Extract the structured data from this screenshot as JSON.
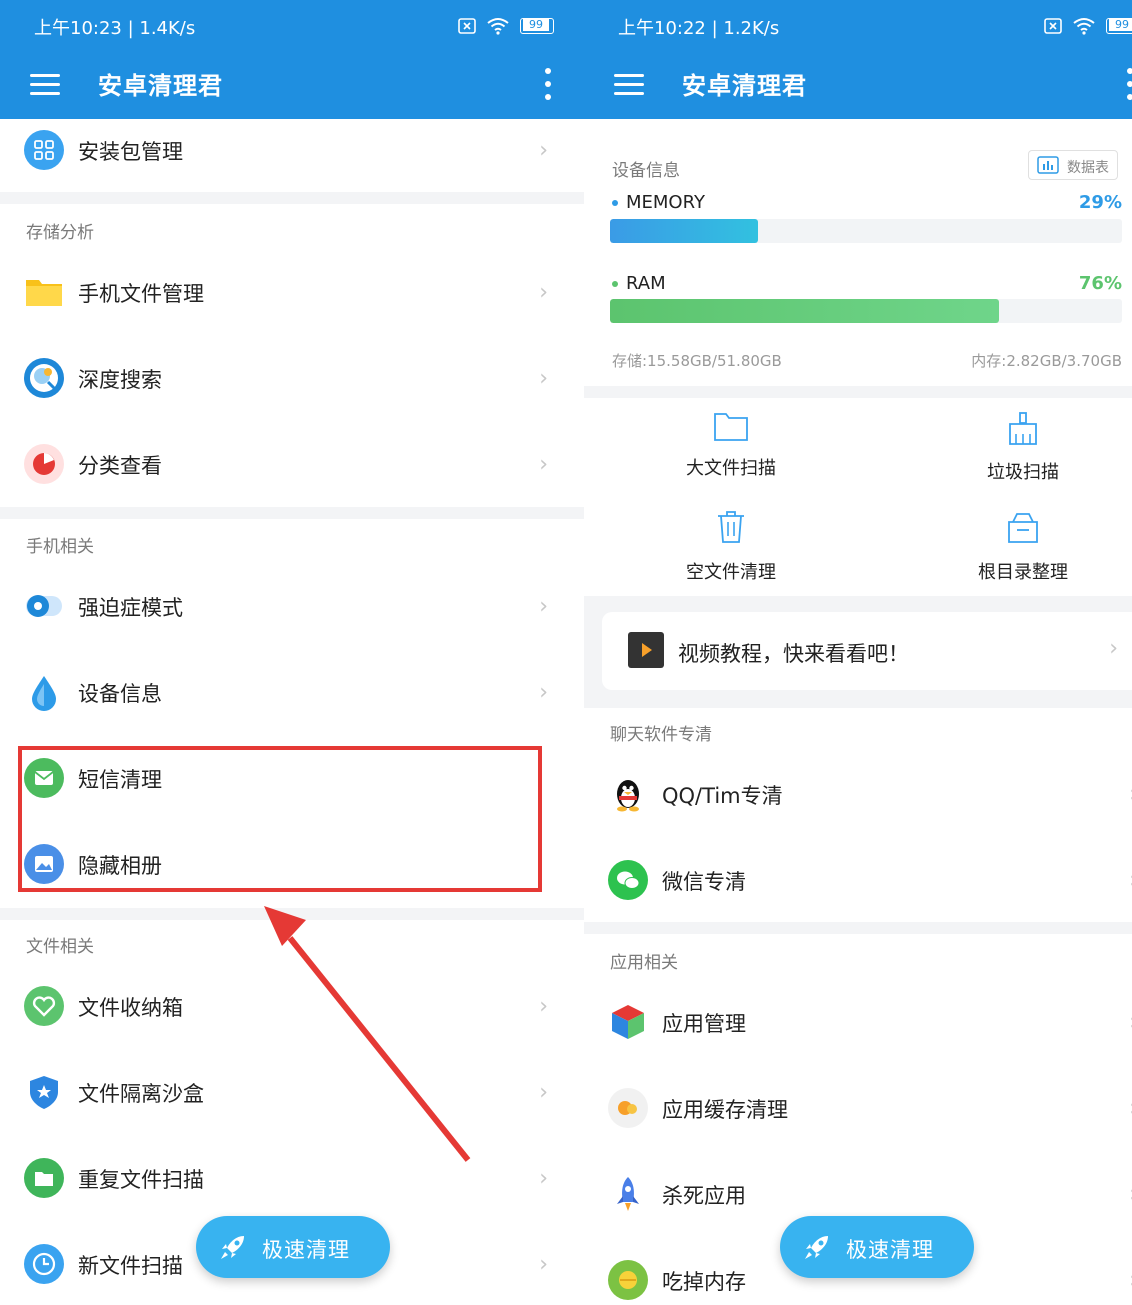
{
  "left": {
    "status": {
      "time": "上午10:23 | 1.4K/s",
      "battery": "99"
    },
    "app_title": "安卓清理君",
    "top_item": {
      "label": "安装包管理"
    },
    "sections": [
      {
        "title": "存储分析",
        "items": [
          {
            "label": "手机文件管理"
          },
          {
            "label": "深度搜索"
          },
          {
            "label": "分类查看"
          }
        ]
      },
      {
        "title": "手机相关",
        "items": [
          {
            "label": "强迫症模式"
          },
          {
            "label": "设备信息"
          },
          {
            "label": "短信清理"
          },
          {
            "label": "隐藏相册"
          }
        ]
      },
      {
        "title": "文件相关",
        "items": [
          {
            "label": "文件收纳箱"
          },
          {
            "label": "文件隔离沙盒"
          },
          {
            "label": "重复文件扫描"
          },
          {
            "label": "新文件扫描"
          }
        ]
      }
    ],
    "fab_label": "极速清理"
  },
  "right": {
    "status": {
      "time": "上午10:22 | 1.2K/s",
      "battery": "99"
    },
    "app_title": "安卓清理君",
    "device_info": {
      "title": "设备信息",
      "data_table_label": "数据表",
      "memory": {
        "label": "MEMORY",
        "percent_text": "29%",
        "fraction": 0.29,
        "color": "#2e9be6"
      },
      "ram": {
        "label": "RAM",
        "percent_text": "76%",
        "fraction": 0.76,
        "color": "#5cc46e"
      },
      "storage_text": "存储:15.58GB/51.80GB",
      "memory_text": "内存:2.82GB/3.70GB"
    },
    "tools": [
      {
        "label": "大文件扫描",
        "icon": "folder-icon"
      },
      {
        "label": "垃圾扫描",
        "icon": "broom-icon"
      },
      {
        "label": "空文件清理",
        "icon": "trash-icon"
      },
      {
        "label": "根目录整理",
        "icon": "organize-box-icon"
      }
    ],
    "video_banner": "视频教程，快来看看吧！",
    "chat_section": {
      "title": "聊天软件专清",
      "items": [
        {
          "label": "QQ/Tim专清"
        },
        {
          "label": "微信专清"
        }
      ]
    },
    "app_section": {
      "title": "应用相关",
      "items": [
        {
          "label": "应用管理"
        },
        {
          "label": "应用缓存清理"
        },
        {
          "label": "杀死应用"
        },
        {
          "label": "吃掉内存"
        }
      ]
    },
    "fab_label": "极速清理"
  },
  "colors": {
    "app_bar": "#1f8fe0",
    "highlight": "#e53935",
    "fab": "#38b3f0"
  }
}
